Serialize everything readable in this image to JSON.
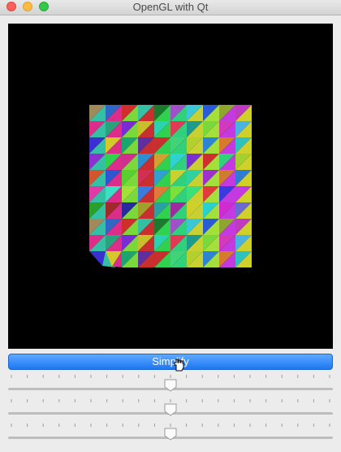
{
  "window": {
    "title": "OpenGL with Qt"
  },
  "viewport": {
    "background": "#000000",
    "mesh_colors": [
      "#a2895b",
      "#2f67c4",
      "#d12d2d",
      "#33c0a4",
      "#1c7a2f",
      "#a050c8",
      "#3cc7d6",
      "#2a5bd7",
      "#8fa52b",
      "#c03ac0",
      "#dc2d8a",
      "#29a37b",
      "#7b2ad6",
      "#c7c02b",
      "#2bd2b0",
      "#e03a57",
      "#1f9b8d",
      "#7ad83a",
      "#d23ab9",
      "#4bb3e0",
      "#3a2fd0",
      "#d7c82a",
      "#1aa66e",
      "#5d2fa1",
      "#c92f2f",
      "#42d37a",
      "#b4d02c",
      "#2c85d4",
      "#d67a2c",
      "#2fc0c0",
      "#8d2fd1",
      "#2fd14f",
      "#d12f8d",
      "#2f8dd1",
      "#d1a02f",
      "#2fd1d1",
      "#7b2fd1",
      "#d12f2f",
      "#2fd17b",
      "#a0d12f",
      "#d1562f",
      "#2f56d1",
      "#56d12f",
      "#d12f56",
      "#2fa0d1",
      "#c8d12f",
      "#2fd1a0",
      "#a02fd1",
      "#d17b2f",
      "#2f7bd1",
      "#e03aa4",
      "#3ae0c4",
      "#a4e03a",
      "#3a7be0",
      "#e07b3a",
      "#7be03a",
      "#3ae07b",
      "#e03a3a",
      "#3a3ae0",
      "#c43ae0",
      "#2aa02a",
      "#a02a2a",
      "#2a2aa0",
      "#a0a02a",
      "#2aa0a0",
      "#a02aa0",
      "#d0d02a",
      "#2ad0d0",
      "#d02ad0",
      "#6a6ad0"
    ]
  },
  "simplify_button": {
    "label": "Simplify"
  },
  "sliders": [
    {
      "name": "slider-1",
      "value_percent": 50
    },
    {
      "name": "slider-2",
      "value_percent": 50
    },
    {
      "name": "slider-3",
      "value_percent": 50
    }
  ]
}
